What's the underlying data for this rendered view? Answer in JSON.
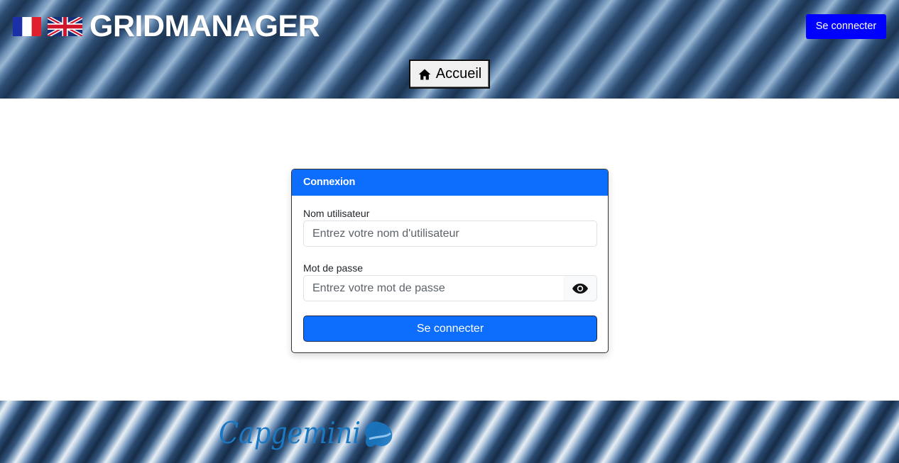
{
  "header": {
    "app_title": "GRIDMANAGER",
    "login_button": "Se connecter",
    "home_button": "Accueil",
    "languages": [
      {
        "code": "fr",
        "icon": "france-flag-icon"
      },
      {
        "code": "en",
        "icon": "uk-flag-icon"
      }
    ]
  },
  "login_card": {
    "title": "Connexion",
    "username_label": "Nom utilisateur",
    "username_placeholder": "Entrez votre nom d'utilisateur",
    "username_value": "",
    "password_label": "Mot de passe",
    "password_placeholder": "Entrez votre mot de passe",
    "password_value": "",
    "show_password_icon": "eye-icon",
    "submit_button": "Se connecter"
  },
  "footer": {
    "logo_text": "Capgemini"
  },
  "colors": {
    "primary": "#0d6efd",
    "header_login": "#0000ff",
    "title_text": "#ffffff"
  }
}
